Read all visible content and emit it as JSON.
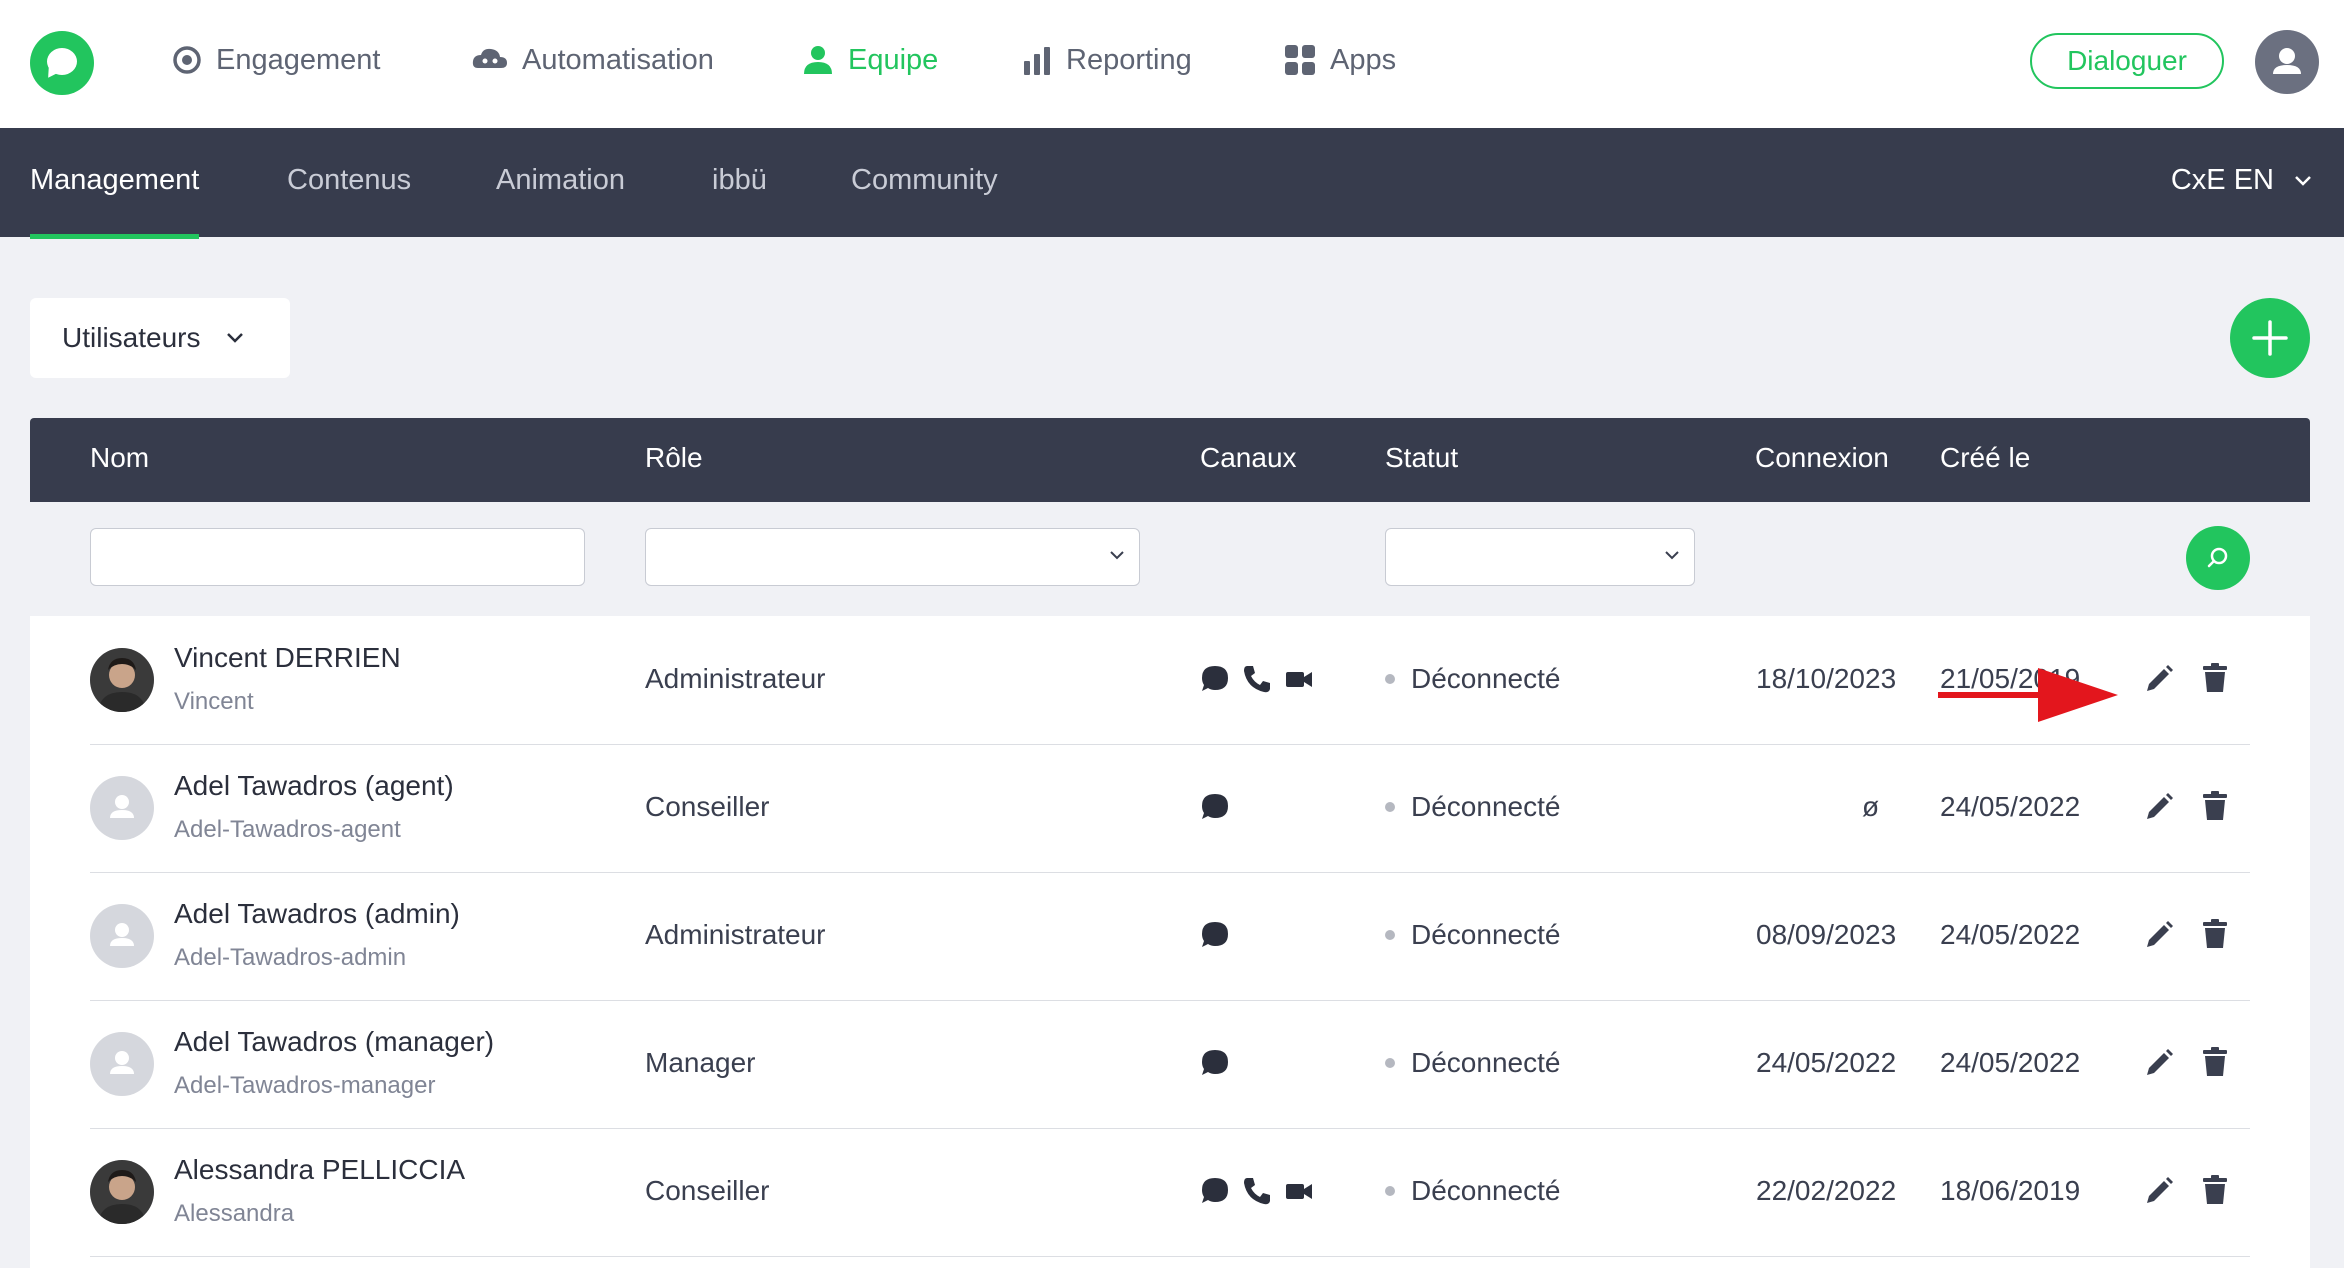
{
  "topnav": {
    "items": [
      {
        "label": "Engagement",
        "icon": "target-icon"
      },
      {
        "label": "Automatisation",
        "icon": "cloud-bot-icon"
      },
      {
        "label": "Equipe",
        "icon": "user-icon",
        "active": true
      },
      {
        "label": "Reporting",
        "icon": "bar-chart-icon"
      },
      {
        "label": "Apps",
        "icon": "grid-icon"
      }
    ],
    "dialoguer_label": "Dialoguer"
  },
  "subnav": {
    "items": [
      {
        "label": "Management",
        "active": true
      },
      {
        "label": "Contenus"
      },
      {
        "label": "Animation"
      },
      {
        "label": "ibbü"
      },
      {
        "label": "Community"
      }
    ],
    "workspace": "CxE EN"
  },
  "toolbar": {
    "selector_label": "Utilisateurs"
  },
  "table": {
    "headers": {
      "name": "Nom",
      "role": "Rôle",
      "channels": "Canaux",
      "status": "Statut",
      "connexion": "Connexion",
      "created": "Créé le"
    },
    "rows": [
      {
        "name": "Vincent DERRIEN",
        "login": "Vincent",
        "role": "Administrateur",
        "channels": [
          "chat",
          "phone",
          "video"
        ],
        "status": "Déconnecté",
        "connexion": "18/10/2023",
        "created": "21/05/2019",
        "avatar": "photo"
      },
      {
        "name": "Adel Tawadros (agent)",
        "login": "Adel-Tawadros-agent",
        "role": "Conseiller",
        "channels": [
          "chat"
        ],
        "status": "Déconnecté",
        "connexion": "ø",
        "created": "24/05/2022",
        "avatar": "default"
      },
      {
        "name": "Adel Tawadros (admin)",
        "login": "Adel-Tawadros-admin",
        "role": "Administrateur",
        "channels": [
          "chat"
        ],
        "status": "Déconnecté",
        "connexion": "08/09/2023",
        "created": "24/05/2022",
        "avatar": "default"
      },
      {
        "name": "Adel Tawadros (manager)",
        "login": "Adel-Tawadros-manager",
        "role": "Manager",
        "channels": [
          "chat"
        ],
        "status": "Déconnecté",
        "connexion": "24/05/2022",
        "created": "24/05/2022",
        "avatar": "default"
      },
      {
        "name": "Alessandra PELLICCIA",
        "login": "Alessandra",
        "role": "Conseiller",
        "channels": [
          "chat",
          "phone",
          "video"
        ],
        "status": "Déconnecté",
        "connexion": "22/02/2022",
        "created": "18/06/2019",
        "avatar": "photo"
      }
    ]
  },
  "colors": {
    "accent": "#22c55e",
    "dark": "#373c4d",
    "annotation": "#e3161d"
  }
}
